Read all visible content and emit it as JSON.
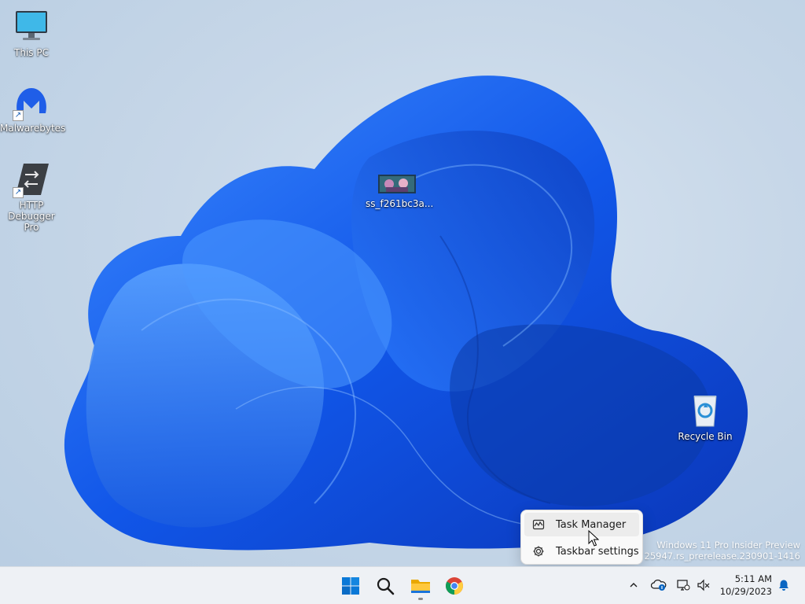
{
  "desktop": {
    "icons": [
      {
        "name": "This PC",
        "icon": "monitor-icon"
      },
      {
        "name": "Malwarebytes",
        "icon": "malwarebytes-icon"
      },
      {
        "name": "HTTP Debugger Pro",
        "icon": "http-debugger-icon"
      },
      {
        "name": "ss_f261bc3a...",
        "icon": "image-thumbnail-icon"
      },
      {
        "name": "Recycle Bin",
        "icon": "recycle-bin-icon"
      }
    ]
  },
  "context_menu": {
    "items": [
      {
        "label": "Task Manager",
        "icon": "task-manager-icon"
      },
      {
        "label": "Taskbar settings",
        "icon": "gear-icon"
      }
    ]
  },
  "watermark": {
    "line1": "Windows 11 Pro Insider Preview",
    "line2": "Build 25947.rs_prerelease.230901-1416"
  },
  "taskbar": {
    "apps": [
      {
        "name": "Start",
        "icon": "windows-start-icon"
      },
      {
        "name": "Search",
        "icon": "search-icon"
      },
      {
        "name": "File Explorer",
        "icon": "file-explorer-icon",
        "running": true
      },
      {
        "name": "Google Chrome",
        "icon": "chrome-icon"
      }
    ],
    "tray": {
      "icons": [
        "chevron-up-icon",
        "onedrive-icon",
        "network-icon",
        "volume-muted-icon"
      ],
      "time": "5:11 AM",
      "date": "10/29/2023",
      "notification_icon": "bell-icon"
    }
  },
  "colors": {
    "accent": "#0067c0",
    "bloom_blue": "#1a63e6",
    "taskbar_bg": "#eef1f5"
  }
}
